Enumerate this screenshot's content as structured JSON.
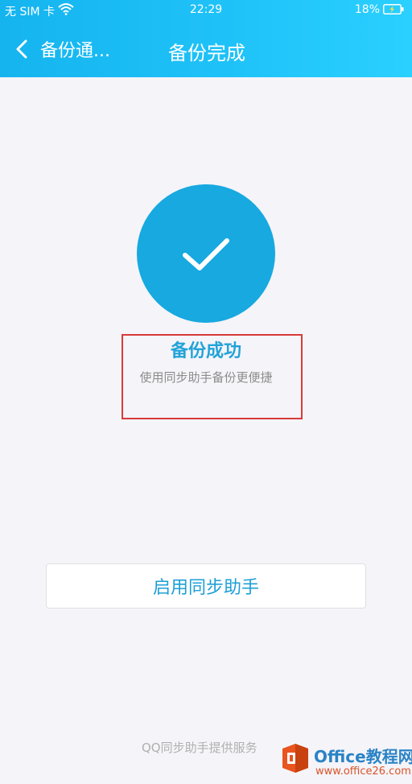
{
  "status_bar": {
    "carrier": "无 SIM 卡",
    "time": "22:29",
    "battery": "18%"
  },
  "nav": {
    "back_label": "备份通...",
    "title": "备份完成"
  },
  "result": {
    "title": "备份成功",
    "subtitle": "使用同步助手备份更便捷"
  },
  "action": {
    "button_label": "启用同步助手"
  },
  "footer": {
    "text": "QQ同步助手提供服务"
  },
  "watermark": {
    "name": "Office教程网",
    "url": "www.office26.com"
  },
  "colors": {
    "header": "#1fc2f8",
    "accent": "#17a9df",
    "highlight_border": "#d93a3a"
  }
}
